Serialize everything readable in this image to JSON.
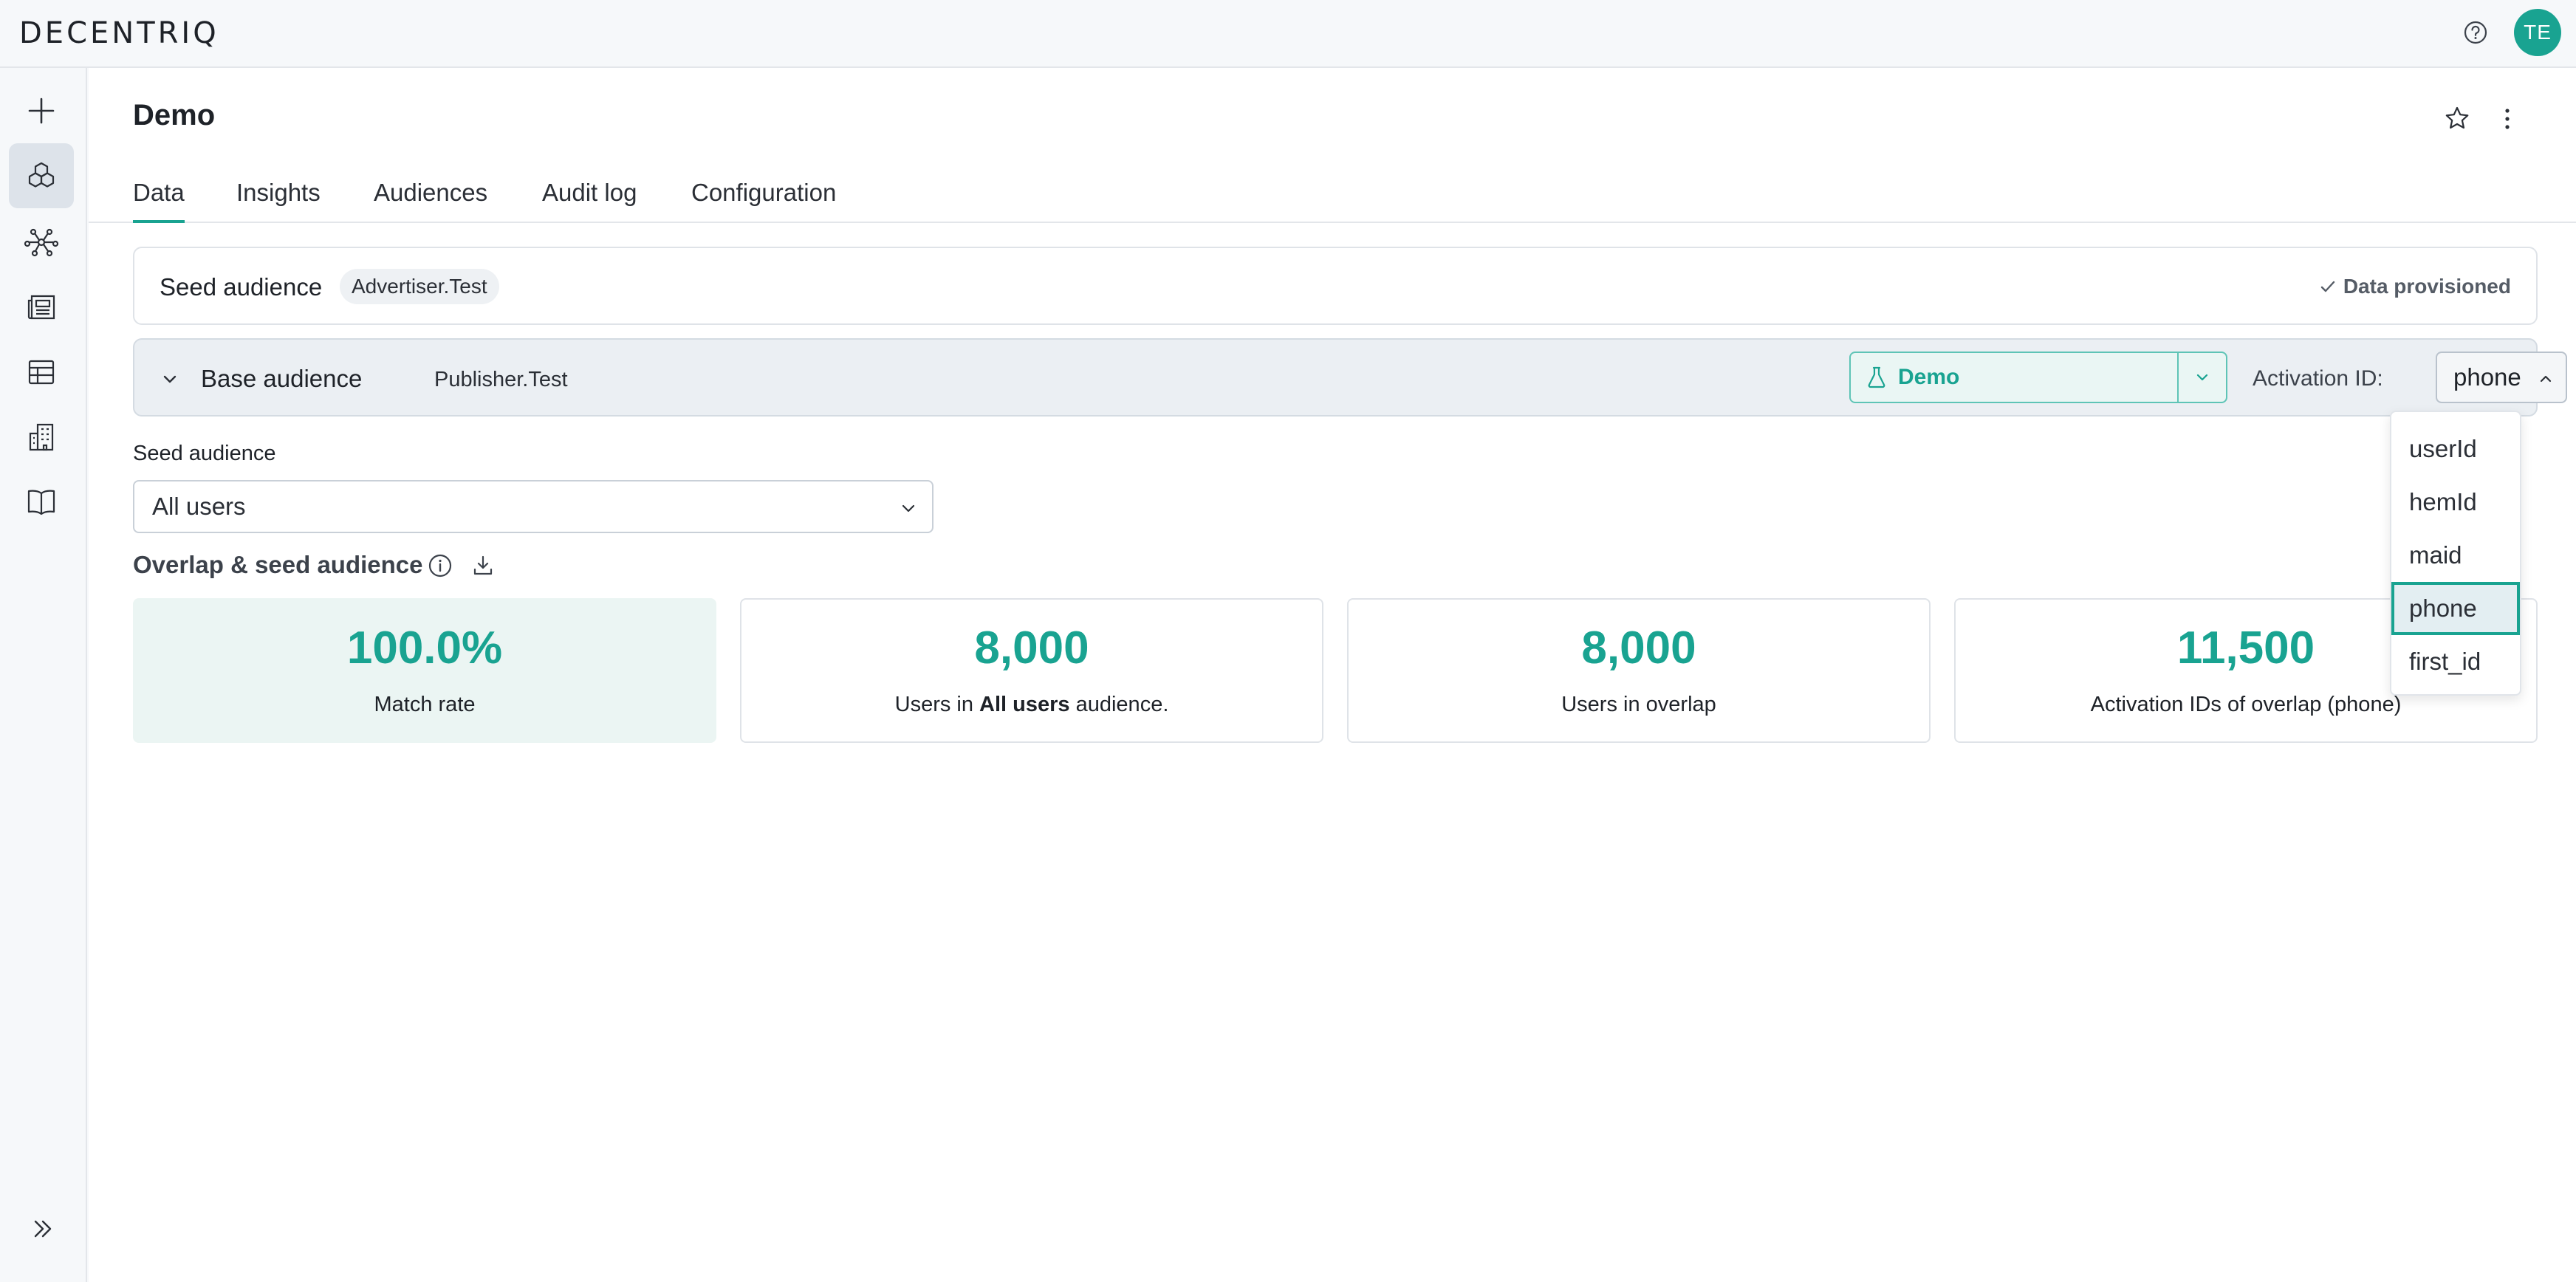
{
  "app": {
    "logo": "DECENTRIQ",
    "user_initials": "TE",
    "accent": "#19a391"
  },
  "page": {
    "title": "Demo"
  },
  "tabs": [
    {
      "label": "Data",
      "active": true
    },
    {
      "label": "Insights",
      "active": false
    },
    {
      "label": "Audiences",
      "active": false
    },
    {
      "label": "Audit log",
      "active": false
    },
    {
      "label": "Configuration",
      "active": false
    }
  ],
  "sidebar": {
    "items": [
      {
        "icon": "plus-icon"
      },
      {
        "icon": "cubes-icon",
        "active": true
      },
      {
        "icon": "network-icon"
      },
      {
        "icon": "newspaper-icon"
      },
      {
        "icon": "table-icon"
      },
      {
        "icon": "buildings-icon"
      },
      {
        "icon": "book-icon"
      }
    ],
    "collapse_icon": "double-chevron-right-icon"
  },
  "seed_audience_card": {
    "title": "Seed audience",
    "chip": "Advertiser.Test",
    "status": "Data provisioned"
  },
  "base_audience_card": {
    "title": "Base audience",
    "subtitle": "Publisher.Test",
    "environment_select": "Demo",
    "activation_label": "Activation ID:",
    "activation_value": "phone"
  },
  "activation_menu": {
    "options": [
      "userId",
      "hemId",
      "maid",
      "phone",
      "first_id"
    ],
    "selected": "phone"
  },
  "seed_select": {
    "label": "Seed audience",
    "value": "All users"
  },
  "overlap": {
    "title": "Overlap & seed audience",
    "stats": [
      {
        "value": "100.0%",
        "label": "Match rate"
      },
      {
        "value": "8,000",
        "label_pre": "Users in ",
        "label_bold": "All users",
        "label_post": " audience."
      },
      {
        "value": "8,000",
        "label": "Users in overlap"
      },
      {
        "value": "11,500",
        "label": "Activation IDs of overlap (phone)"
      }
    ]
  }
}
